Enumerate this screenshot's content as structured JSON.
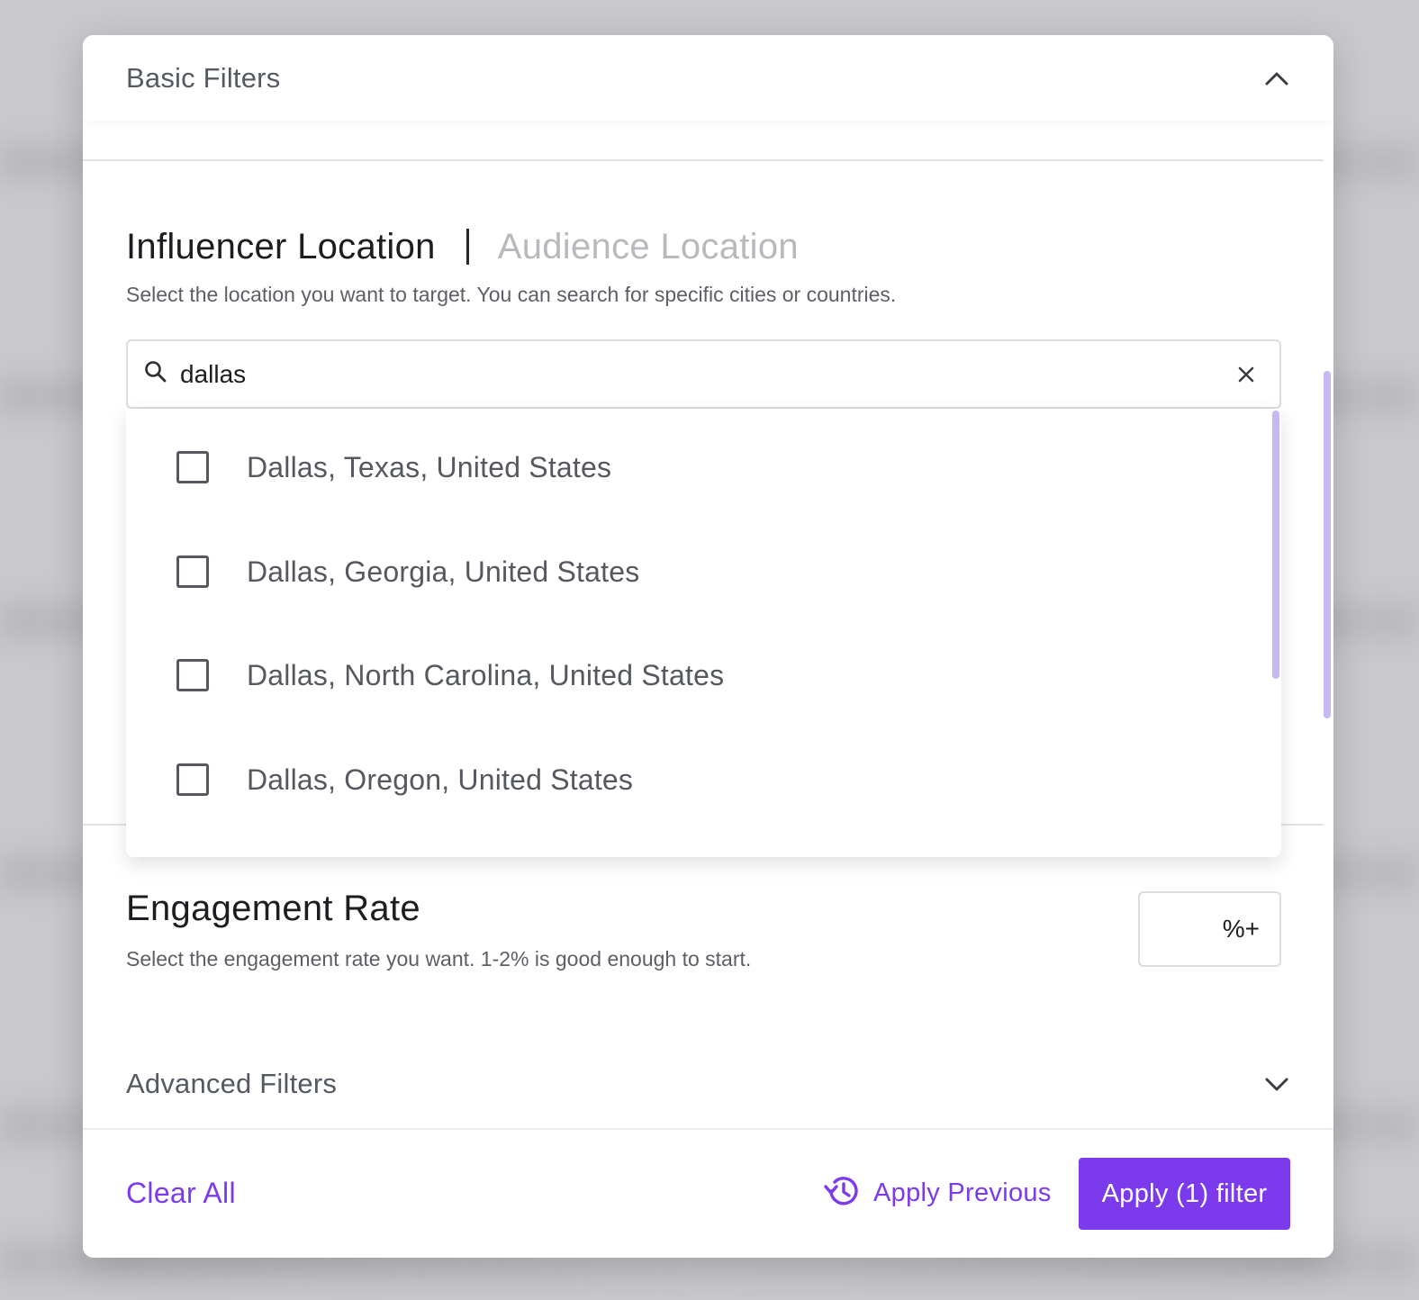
{
  "basic_filters": {
    "title": "Basic Filters"
  },
  "location": {
    "tab_active": "Influencer Location",
    "tab_inactive": "Audience Location",
    "helper": "Select the location you want to target. You can search for specific cities or countries.",
    "search_value": "dallas",
    "options": [
      "Dallas, Texas, United States",
      "Dallas, Georgia, United States",
      "Dallas, North Carolina, United States",
      "Dallas, Oregon, United States"
    ]
  },
  "engagement": {
    "title": "Engagement Rate",
    "helper": "Select the engagement rate you want. 1-2% is good enough to start.",
    "suffix": "%+"
  },
  "advanced_filters": {
    "title": "Advanced Filters"
  },
  "footer": {
    "clear_all": "Clear All",
    "apply_previous": "Apply Previous",
    "apply_button": "Apply (1) filter"
  },
  "colors": {
    "accent": "#7c3aed",
    "scrollbar": "#c7b8f2",
    "backdrop": "#c9c8cc"
  }
}
